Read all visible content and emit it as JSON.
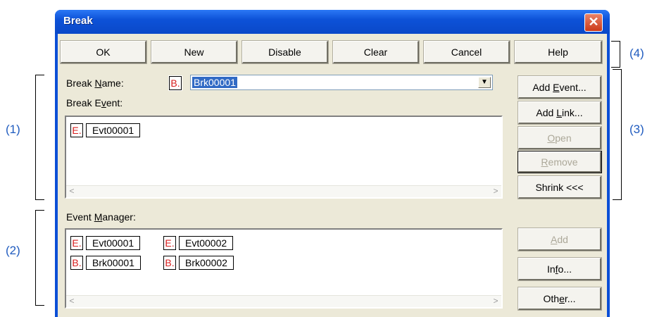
{
  "window": {
    "title": "Break",
    "close_glyph": "✕"
  },
  "toolbar": {
    "buttons": [
      "OK",
      "New",
      "Disable",
      "Clear",
      "Cancel",
      "Help"
    ]
  },
  "break_name": {
    "label_pre": "Break ",
    "label_u": "N",
    "label_post": "ame:",
    "icon": "B.",
    "value": "Brk00001"
  },
  "break_event": {
    "label_pre": "Break E",
    "label_u": "v",
    "label_post": "ent:",
    "items": [
      {
        "icon": "E.",
        "name": "Evt00001"
      }
    ]
  },
  "event_manager": {
    "label_pre": "Event ",
    "label_u": "M",
    "label_post": "anager:",
    "items": [
      {
        "icon": "E.",
        "name": "Evt00001"
      },
      {
        "icon": "E.",
        "name": "Evt00002"
      },
      {
        "icon": "B.",
        "name": "Brk00001"
      },
      {
        "icon": "B.",
        "name": "Brk00002"
      }
    ]
  },
  "side_buttons": {
    "add_event": {
      "pre": "Add ",
      "u": "E",
      "post": "vent..."
    },
    "add_link": {
      "pre": "Add ",
      "u": "L",
      "post": "ink..."
    },
    "open": {
      "pre": "",
      "u": "O",
      "post": "pen"
    },
    "remove": {
      "pre": "",
      "u": "R",
      "post": "emove"
    },
    "shrink": "Shrink <<<",
    "add": {
      "pre": "",
      "u": "A",
      "post": "dd"
    },
    "info": {
      "pre": "In",
      "u": "f",
      "post": "o..."
    },
    "other": {
      "pre": "Oth",
      "u": "e",
      "post": "r..."
    }
  },
  "annotations": [
    "(1)",
    "(2)",
    "(3)",
    "(4)"
  ],
  "scroll": {
    "left": "<",
    "right": ">"
  },
  "colors": {
    "title_blue": "#0d52d8",
    "icon_red": "#d81e1e",
    "annotation_blue": "#1f5bbf"
  }
}
